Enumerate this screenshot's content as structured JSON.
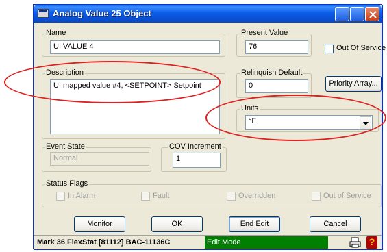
{
  "window": {
    "title": "Analog Value 25 Object"
  },
  "fields": {
    "name": {
      "label": "Name",
      "value": "UI VALUE 4"
    },
    "present_value": {
      "label": "Present Value",
      "value": "76"
    },
    "out_of_service": {
      "label": "Out Of Service",
      "checked": false
    },
    "description": {
      "label": "Description",
      "value": "UI mapped value #4, <SETPOINT> Setpoint"
    },
    "relinquish_default": {
      "label": "Relinquish Default",
      "value": "0"
    },
    "priority_array_button": "Priority Array...",
    "units": {
      "label": "Units",
      "value": "°F"
    },
    "event_state": {
      "label": "Event State",
      "value": "Normal"
    },
    "cov_increment": {
      "label": "COV Increment",
      "value": "1"
    }
  },
  "status_flags": {
    "label": "Status Flags",
    "items": [
      {
        "label": "In Alarm",
        "checked": false
      },
      {
        "label": "Fault",
        "checked": false
      },
      {
        "label": "Overridden",
        "checked": false
      },
      {
        "label": "Out of Service",
        "checked": false
      }
    ]
  },
  "buttons": {
    "monitor": "Monitor",
    "ok": "OK",
    "end_edit": "End Edit",
    "cancel": "Cancel"
  },
  "statusbar": {
    "device": "Mark 36 FlexStat [81112] BAC-11136C",
    "mode": "Edit Mode",
    "mode_color": "#008000",
    "print_icon": "printer-icon",
    "help_icon": "help-icon"
  },
  "annotation_color": "#e02020"
}
